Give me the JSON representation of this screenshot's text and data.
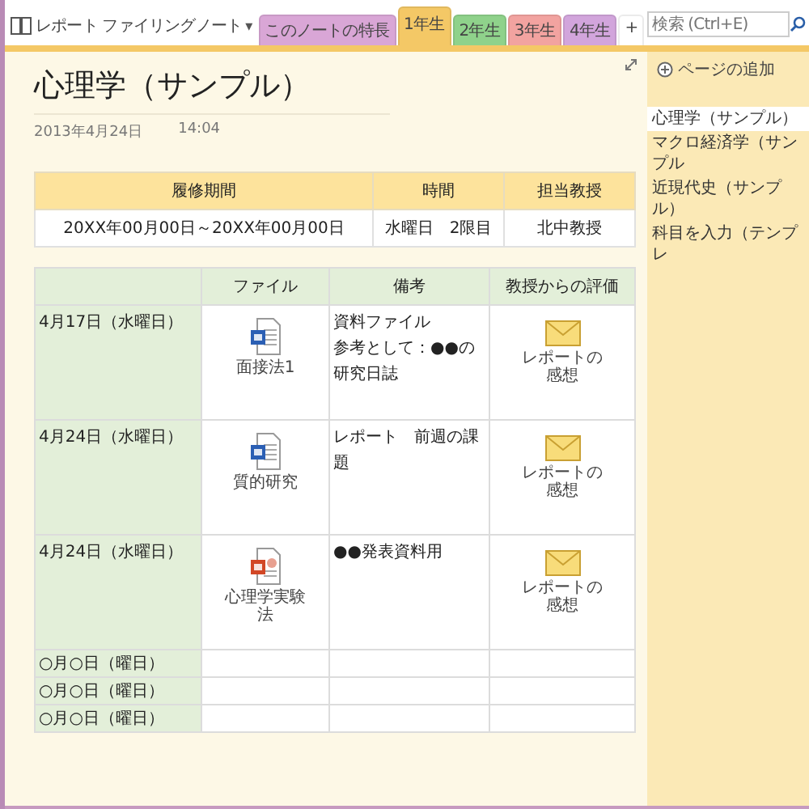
{
  "notebook": {
    "title": "レポート ファイリングノート",
    "caret": "▾"
  },
  "tabs": [
    {
      "label": "このノートの特長",
      "color": "#d9a6d6",
      "selected": false
    },
    {
      "label": "1年生",
      "color": "#f4c866",
      "selected": true
    },
    {
      "label": "2年生",
      "color": "#8fd28b",
      "selected": false
    },
    {
      "label": "3年生",
      "color": "#f2a3a0",
      "selected": false
    },
    {
      "label": "4年生",
      "color": "#d2a5dc",
      "selected": false
    },
    {
      "label": "+",
      "color": "#ffffff",
      "selected": false
    }
  ],
  "search": {
    "placeholder": "検索 (Ctrl+E)"
  },
  "page": {
    "title": "心理学（サンプル）",
    "date": "2013年4月24日",
    "time": "14:04"
  },
  "course_table": {
    "columns": [
      "履修期間",
      "時間",
      "担当教授"
    ],
    "row": [
      "20XX年00月00日～20XX年00月00日",
      "水曜日　2限目",
      "北中教授"
    ]
  },
  "schedule": {
    "columns": [
      "ファイル",
      "備考",
      "教授からの評価"
    ],
    "rows": [
      {
        "date": "4月17日（水曜日）",
        "file": {
          "kind": "word",
          "name": "面接法1"
        },
        "notes": [
          "資料ファイル",
          "参考として：●●の研究日誌"
        ],
        "evaluation": "レポートの感想"
      },
      {
        "date": "4月24日（水曜日）",
        "file": {
          "kind": "word",
          "name": "質的研究"
        },
        "notes": [
          "レポート　前週の課題"
        ],
        "evaluation": "レポートの感想"
      },
      {
        "date": "4月24日（水曜日）",
        "file": {
          "kind": "powerpoint",
          "name": "心理学実験法"
        },
        "notes": [
          "●●発表資料用"
        ],
        "evaluation": "レポートの感想"
      },
      {
        "date": "○月○日（曜日）"
      },
      {
        "date": "○月○日（曜日）"
      },
      {
        "date": "○月○日（曜日）"
      }
    ]
  },
  "sidebar": {
    "add_page": "ページの追加",
    "pages": [
      {
        "label": "心理学（サンプル）",
        "selected": true
      },
      {
        "label": "マクロ経済学（サンプル",
        "selected": false
      },
      {
        "label": "近現代史（サンプル）",
        "selected": false
      },
      {
        "label": "科目を入力（テンプレ",
        "selected": false
      }
    ]
  }
}
